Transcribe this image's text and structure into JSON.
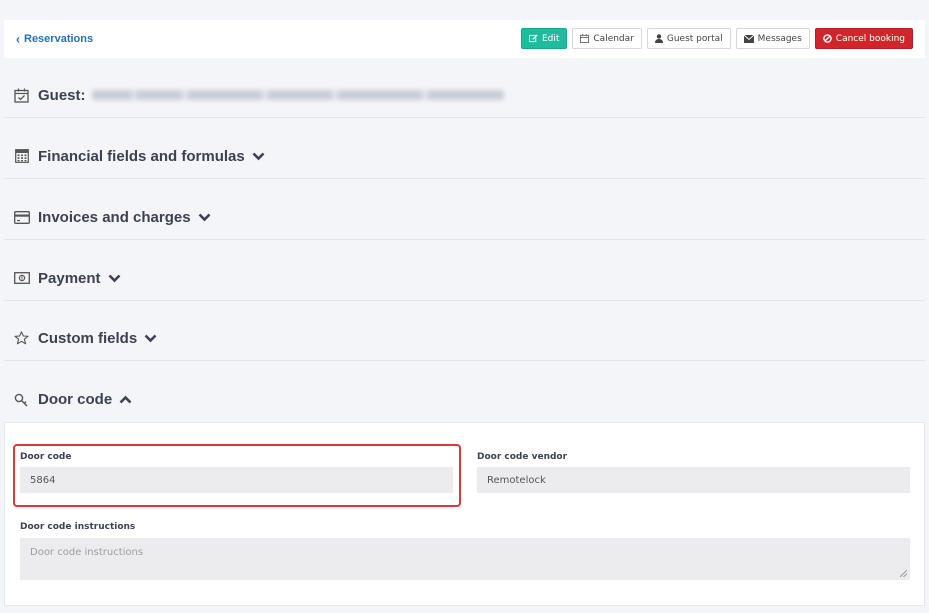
{
  "topbar": {
    "back_label": "Reservations",
    "buttons": {
      "edit": "Edit",
      "calendar": "Calendar",
      "guest_portal": "Guest portal",
      "messages": "Messages",
      "cancel": "Cancel booking"
    }
  },
  "sections": {
    "guest": {
      "label": "Guest:",
      "icon": "calendar-check-icon"
    },
    "financial": {
      "label": "Financial fields and formulas",
      "icon": "calculator-icon"
    },
    "invoices": {
      "label": "Invoices and charges",
      "icon": "credit-card-icon"
    },
    "payment": {
      "label": "Payment",
      "icon": "money-icon"
    },
    "custom": {
      "label": "Custom fields",
      "icon": "star-icon"
    },
    "door": {
      "label": "Door code",
      "icon": "key-icon"
    }
  },
  "door_code": {
    "code_label": "Door code",
    "code_value": "5864",
    "vendor_label": "Door code vendor",
    "vendor_value": "Remotelock",
    "instructions_label": "Door code instructions",
    "instructions_placeholder": "Door code instructions"
  },
  "colors": {
    "edit_button": "#1ebc9c",
    "cancel_button": "#d0262b",
    "link": "#2a6fb5",
    "highlight": "#e0353b"
  }
}
